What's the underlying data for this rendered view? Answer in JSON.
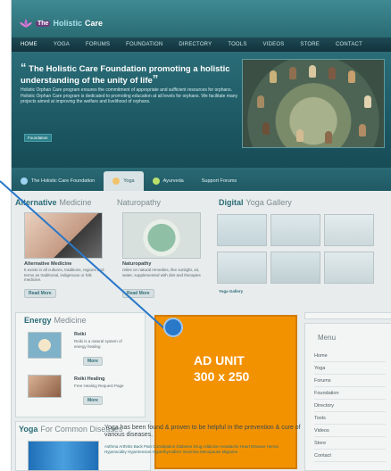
{
  "site": {
    "logo": {
      "the": "The",
      "holistic": "Holistic",
      "care": "Care"
    },
    "nav": [
      "HOME",
      "YOGA",
      "FORUMS",
      "FOUNDATION",
      "DIRECTORY",
      "TOOLS",
      "VIDEOS",
      "STORE",
      "CONTACT"
    ]
  },
  "hero": {
    "quote": "The Holistic Care Foundation promoting a holistic understanding of the unity of life",
    "text": "Holistic Orphan Care program ensures the commitment of appropriate and sufficient resources for orphans. Holistic Orphan Care program is dedicated to promoting education at all levels for orphans. We facilitate many projects aimed at improving the welfare and livelihood of orphans.",
    "tag": "Foundation"
  },
  "tabs": [
    "The Holistic Care Foundation",
    "Yoga",
    "Ayurveda",
    "Support Forums"
  ],
  "sections": {
    "alt": {
      "bold": "Alternative",
      "light": "Medicine"
    },
    "naturo": {
      "light": "Naturopathy"
    },
    "gallery": {
      "bold": "Digital",
      "light": "Yoga Gallery"
    },
    "energy": {
      "bold": "Energy",
      "light": "Medicine"
    },
    "yoga_diseases": {
      "bold": "Yoga",
      "light": "For Common Diseases"
    }
  },
  "alt_medicine": {
    "title": "Alternative Medicine",
    "text": "It exists in all cultures, traditions, regions and terms as traditional, indigenous or folk medicine.",
    "read_more": "Read More"
  },
  "naturopathy": {
    "title": "Naturopathy",
    "text": "relies on natural remedies, like sunlight, air, water, supplemented with diet and therapies",
    "read_more": "Read More"
  },
  "gallery_caption": "Yoga Gallery",
  "reiki": {
    "title": "Reiki",
    "text": "Reiki is a natural system of energy healing",
    "more": "More"
  },
  "reiki_healing": {
    "title": "Reiki Healing",
    "text": "Free Healing Request Page",
    "more": "More"
  },
  "ad": {
    "line1": "AD UNIT",
    "line2": "300 x 250"
  },
  "menu": {
    "title": "Menu",
    "items": [
      "Home",
      "Yoga",
      "Forums",
      "Foundation",
      "Directory",
      "Tools",
      "Videos",
      "Store",
      "Contact"
    ]
  },
  "yoga_text": {
    "headline": "Yoga has been found & proven to be helpful in the prevention & cure of various diseases.",
    "list": "Asthma  Arthritis  Back Pain  Constipation  Diabetes  Drug Addiction  Headache  Heart Disease  Hernia  Hyperacidity  Hypertension  Hyperthyroidism  Insomnia  Menopause  Migraine"
  },
  "colors": {
    "accent": "#2b6c77",
    "ad": "#f39200",
    "callout": "#2a78c8"
  }
}
